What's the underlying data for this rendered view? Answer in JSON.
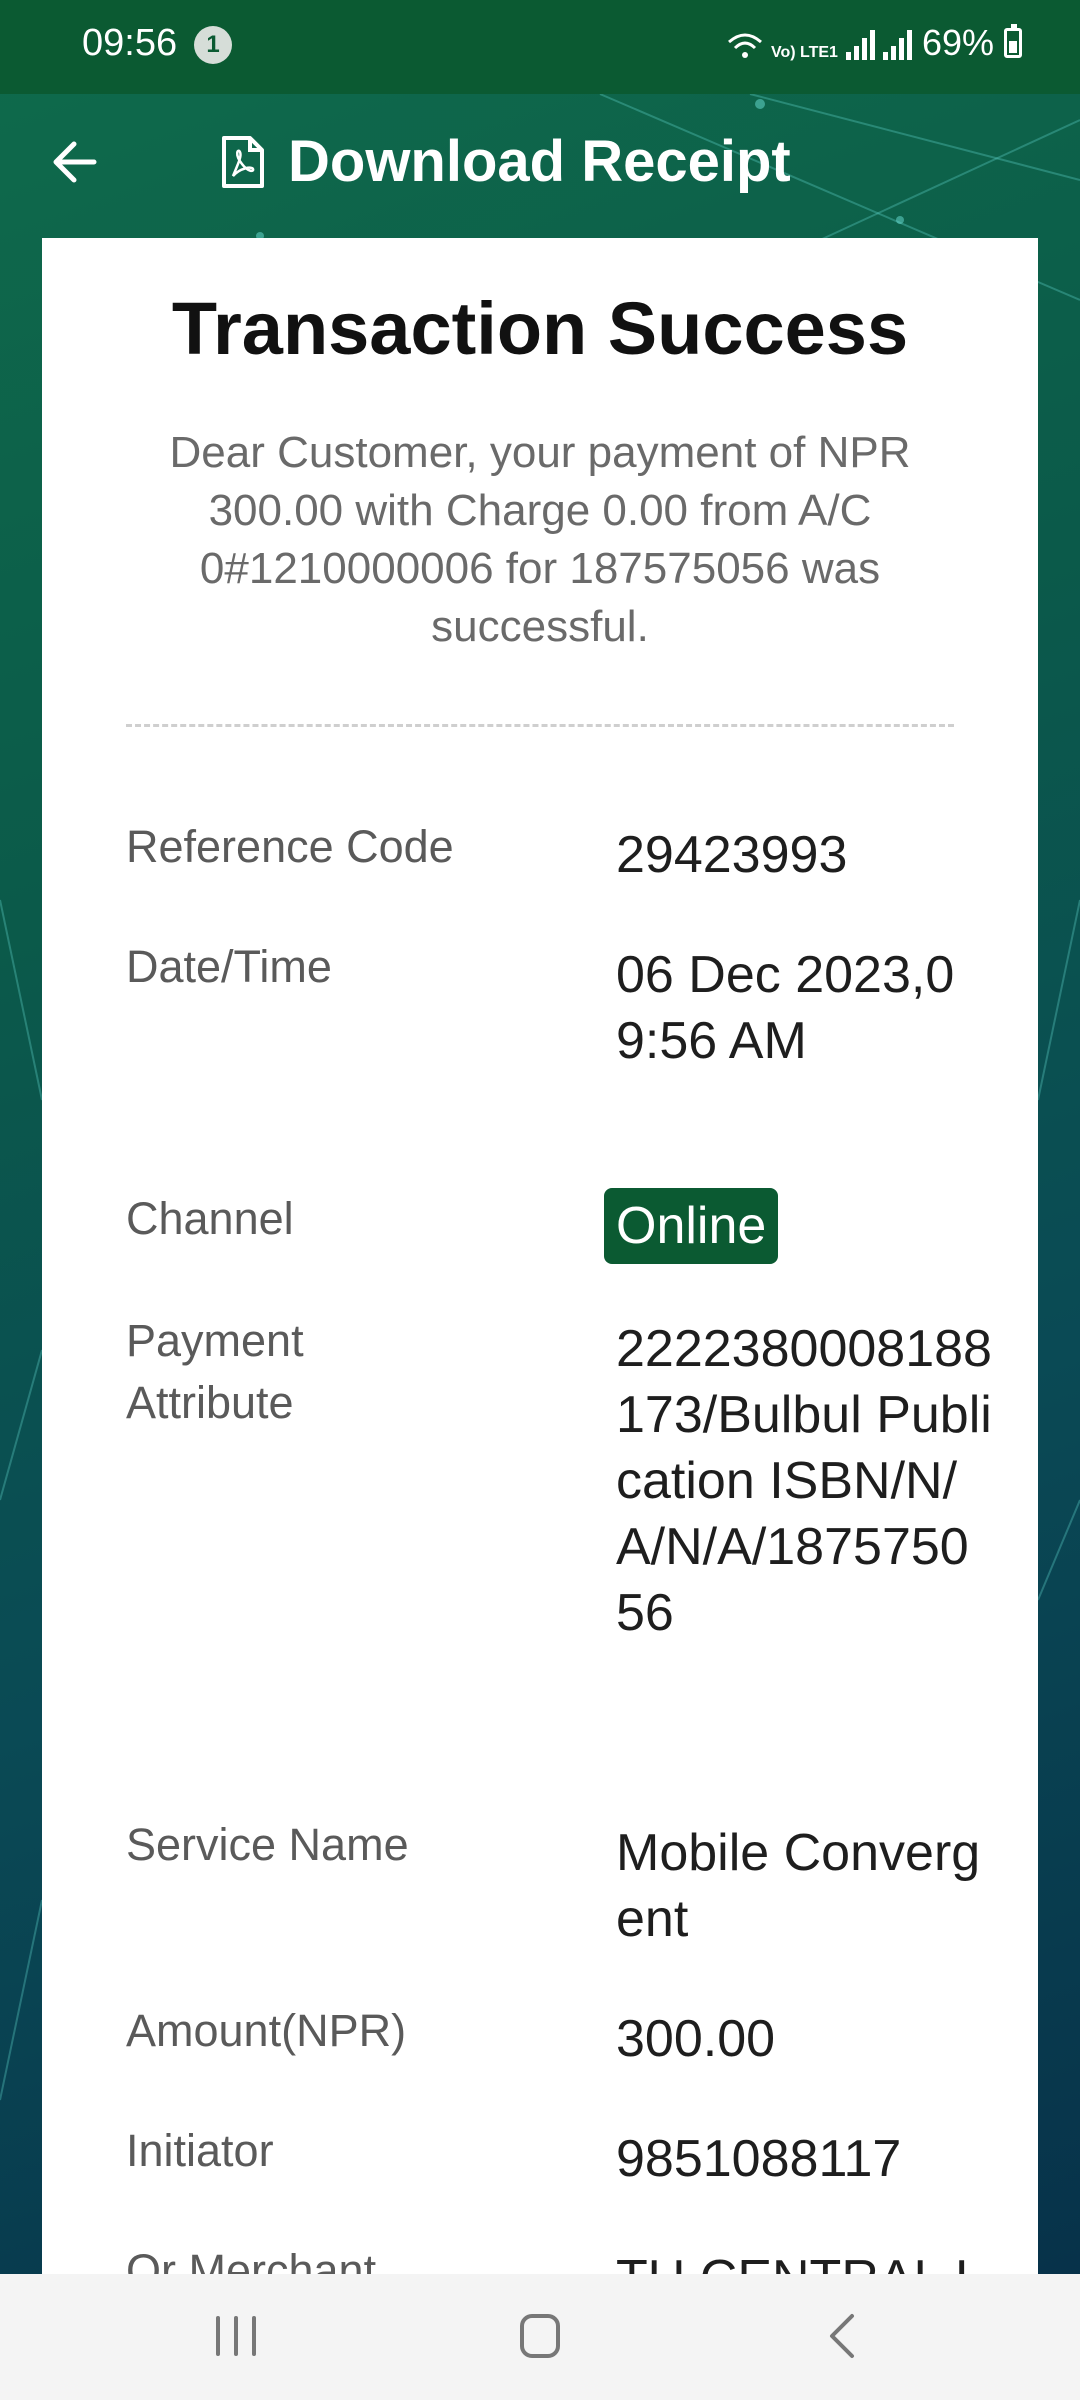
{
  "status_bar": {
    "time": "09:56",
    "notification_count": "1",
    "network_label": "Vo) LTE1",
    "battery": "69%"
  },
  "app_bar": {
    "title": "Download Receipt",
    "back_icon": "arrow-left-icon",
    "title_icon": "pdf-file-icon"
  },
  "receipt": {
    "heading": "Transaction Success",
    "message": "Dear Customer, your payment of NPR 300.00 with Charge 0.00 from A/C 0#1210000006 for 187575056 was successful.",
    "rows": [
      {
        "label": "Reference Code",
        "value": "29423993"
      },
      {
        "label": "Date/Time",
        "value": "06 Dec 2023,09:56 AM"
      },
      {
        "label": "Channel",
        "value": "Online"
      },
      {
        "label": "Payment Attribute",
        "value": "2222380008188173/Bulbul Publication ISBN/N/A/N/A/187575056"
      },
      {
        "label": "Service Name",
        "value": "Mobile Convergent"
      },
      {
        "label": "Amount(NPR)",
        "value": "300.00"
      },
      {
        "label": "Initiator",
        "value": "9851088117"
      },
      {
        "label": "Qr Merchant Name",
        "value": "TU CENTRAL LIBRARY"
      }
    ]
  },
  "nav_bar": {
    "icons": [
      "recent-apps-icon",
      "home-icon",
      "back-icon"
    ]
  },
  "colors": {
    "brand_green": "#0b5a32",
    "card_bg": "#ffffff",
    "label_gray": "#5a5a5a",
    "value_dark": "#1e1e1e"
  }
}
